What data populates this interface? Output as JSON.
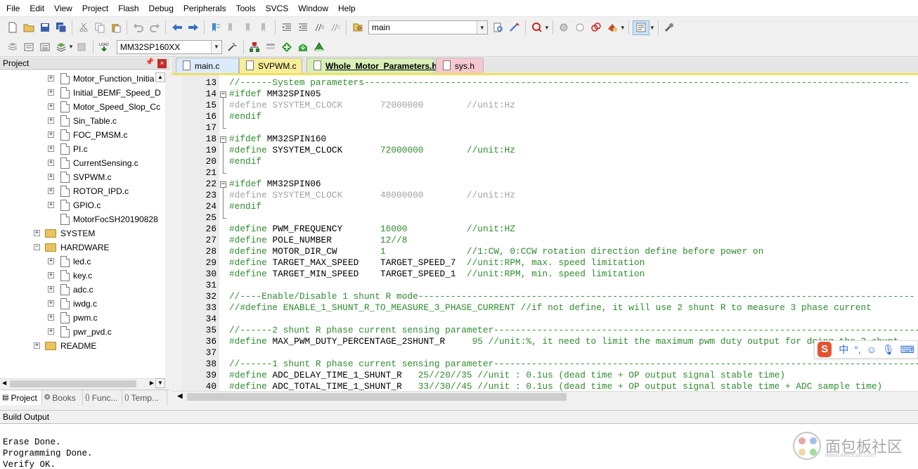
{
  "menu": [
    "File",
    "Edit",
    "View",
    "Project",
    "Flash",
    "Debug",
    "Peripherals",
    "Tools",
    "SVCS",
    "Window",
    "Help"
  ],
  "toolbar1": {
    "find_combo_value": "main"
  },
  "toolbar2": {
    "target_combo_value": "MM32SP160XX"
  },
  "project_panel": {
    "title": "Project",
    "tree": [
      {
        "label": "Motor_Function_Initia",
        "type": "file",
        "expandable": true
      },
      {
        "label": "Initial_BEMF_Speed_D",
        "type": "file",
        "expandable": true
      },
      {
        "label": "Motor_Speed_Slop_Cc",
        "type": "file",
        "expandable": true
      },
      {
        "label": "Sin_Table.c",
        "type": "file",
        "expandable": true
      },
      {
        "label": "FOC_PMSM.c",
        "type": "file",
        "expandable": true
      },
      {
        "label": "PI.c",
        "type": "file",
        "expandable": true
      },
      {
        "label": "CurrentSensing.c",
        "type": "file",
        "expandable": true
      },
      {
        "label": "SVPWM.c",
        "type": "file",
        "expandable": true
      },
      {
        "label": "ROTOR_IPD.c",
        "type": "file",
        "expandable": true
      },
      {
        "label": "GPIO.c",
        "type": "file",
        "expandable": true
      },
      {
        "label": "MotorFocSH20190828",
        "type": "file",
        "expandable": false
      },
      {
        "label": "SYSTEM",
        "type": "folder",
        "expandable": true,
        "expanded": false
      },
      {
        "label": "HARDWARE",
        "type": "folder",
        "expandable": true,
        "expanded": true
      },
      {
        "label": "led.c",
        "type": "file",
        "expandable": true
      },
      {
        "label": "key.c",
        "type": "file",
        "expandable": true
      },
      {
        "label": "adc.c",
        "type": "file",
        "expandable": true
      },
      {
        "label": "iwdg.c",
        "type": "file",
        "expandable": true
      },
      {
        "label": "pwm.c",
        "type": "file",
        "expandable": true
      },
      {
        "label": "pwr_pvd.c",
        "type": "file",
        "expandable": true
      },
      {
        "label": "README",
        "type": "folder",
        "expandable": true,
        "expanded": false
      }
    ],
    "bottom_tabs": [
      {
        "label": "Project",
        "icon": "project-icon",
        "active": true
      },
      {
        "label": "Books",
        "icon": "books-icon",
        "active": false
      },
      {
        "label": "Func...",
        "icon": "{}",
        "active": false
      },
      {
        "label": "Temp...",
        "icon": "0→",
        "active": false
      }
    ]
  },
  "editor": {
    "tabs": [
      {
        "label": "main.c",
        "color": "#dcebfb",
        "active": false
      },
      {
        "label": "SVPWM.c",
        "color": "#f7ee9a",
        "active": false
      },
      {
        "label": "Whole_Motor_Parameters.h",
        "color": "#d9f0b8",
        "active": true
      },
      {
        "label": "sys.h",
        "color": "#f6c8cf",
        "active": false
      }
    ],
    "lines": [
      {
        "n": "13",
        "kind": "comment",
        "text": "//------System parameters-----------------------------------------------------------------------------------------------------"
      },
      {
        "n": "14",
        "kind": "pp",
        "text": "#ifdef MM32SPIN05",
        "fold": "open"
      },
      {
        "n": "15",
        "kind": "inactive",
        "text": "#define SYSYTEM_CLOCK       72000000        //unit:Hz"
      },
      {
        "n": "16",
        "kind": "pp",
        "text": "#endif"
      },
      {
        "n": "17",
        "kind": "blank",
        "text": ""
      },
      {
        "n": "18",
        "kind": "pp",
        "text": "#ifdef MM32SPIN160",
        "fold": "open"
      },
      {
        "n": "19",
        "kind": "define",
        "text": "#define SYSYTEM_CLOCK       72000000        //unit:Hz"
      },
      {
        "n": "20",
        "kind": "pp",
        "text": "#endif"
      },
      {
        "n": "21",
        "kind": "blank",
        "text": ""
      },
      {
        "n": "22",
        "kind": "pp",
        "text": "#ifdef MM32SPIN06",
        "fold": "open"
      },
      {
        "n": "23",
        "kind": "inactive",
        "text": "#define SYSYTEM_CLOCK       48000000        //unit:Hz"
      },
      {
        "n": "24",
        "kind": "pp",
        "text": "#endif"
      },
      {
        "n": "25",
        "kind": "blank",
        "text": ""
      },
      {
        "n": "26",
        "kind": "define",
        "text": "#define PWM_FREQUENCY       16000           //unit:HZ"
      },
      {
        "n": "27",
        "kind": "define",
        "text": "#define POLE_NUMBER         12//8"
      },
      {
        "n": "28",
        "kind": "define",
        "text": "#define MOTOR_DIR_CW        1               //1:CW, 0:CCW rotation direction define before power on"
      },
      {
        "n": "29",
        "kind": "define",
        "text": "#define TARGET_MAX_SPEED    TARGET_SPEED_7  //unit:RPM, max. speed limitation"
      },
      {
        "n": "30",
        "kind": "define",
        "text": "#define TARGET_MIN_SPEED    TARGET_SPEED_1  //unit:RPM, min. speed limitation"
      },
      {
        "n": "31",
        "kind": "blank",
        "text": ""
      },
      {
        "n": "32",
        "kind": "comment",
        "text": "//----Enable/Disable 1 shunt R mode--------------------------------------------------------------------------------------------"
      },
      {
        "n": "33",
        "kind": "comment",
        "text": "//#define ENABLE_1_SHUNT_R_TO_MEASURE_3_PHASE_CURRENT //if not define, it will use 2 shunt R to measure 3 phase current"
      },
      {
        "n": "34",
        "kind": "blank",
        "text": ""
      },
      {
        "n": "35",
        "kind": "comment",
        "text": "//------2 shunt R phase current sensing parameter-------------------------------------------------------------------------------"
      },
      {
        "n": "36",
        "kind": "define",
        "text": "#define MAX_PWM_DUTY_PERCENTAGE_2SHUNT_R     95 //unit:%, it need to limit the maximum pwm duty output for doing the 2 shunt"
      },
      {
        "n": "37",
        "kind": "blank",
        "text": ""
      },
      {
        "n": "38",
        "kind": "comment",
        "text": "//------1 shunt R phase current sensing parameter-------------------------------------------------------------------------------"
      },
      {
        "n": "39",
        "kind": "define",
        "text": "#define ADC_DELAY_TIME_1_SHUNT_R   25//20//35 //unit : 0.1us (dead time + OP output signal stable time)"
      },
      {
        "n": "40",
        "kind": "define",
        "text": "#define ADC_TOTAL_TIME_1_SHUNT_R   33//30//45 //unit : 0.1us (dead time + OP output signal stable time + ADC sample time)"
      }
    ]
  },
  "build_output": {
    "title": "Build Output",
    "lines": [
      "Erase Done.",
      "Programming Done.",
      "Verify OK."
    ]
  },
  "ime": {
    "logo": "S",
    "mode": "中"
  },
  "watermark": {
    "text": "面包板社区",
    "sub": "www.eefocus.com"
  }
}
